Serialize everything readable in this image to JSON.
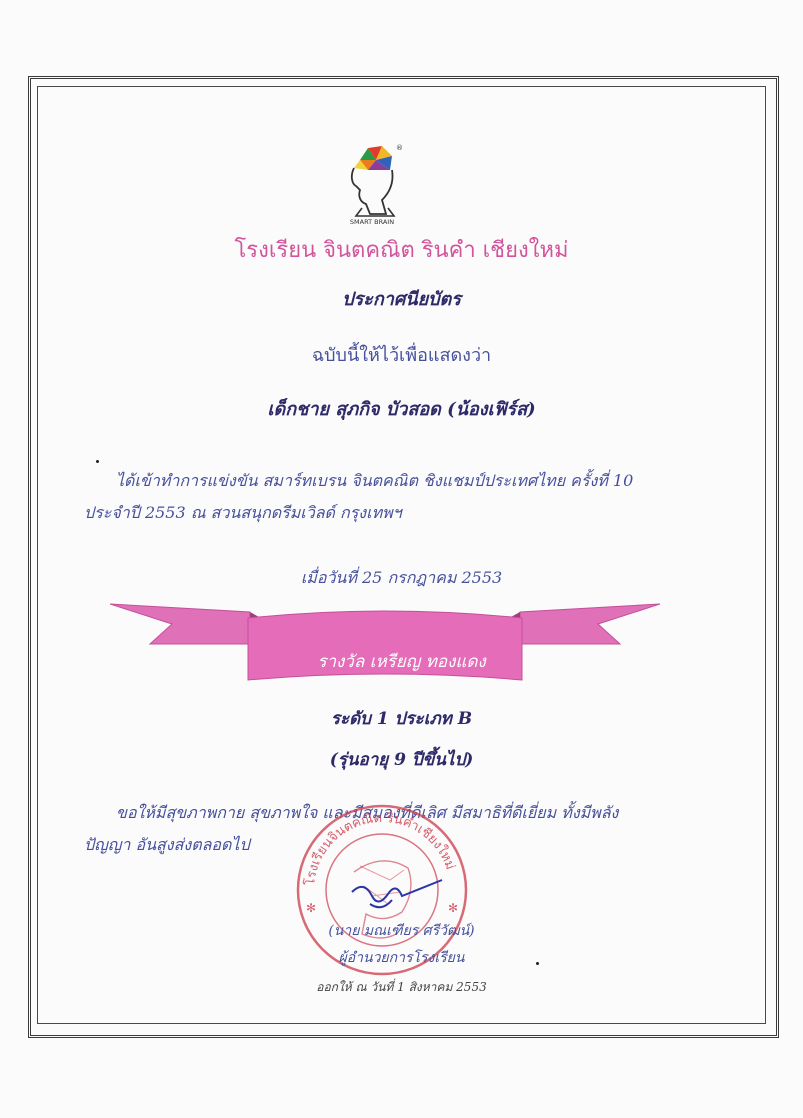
{
  "logo": {
    "caption": "SMART BRAIN",
    "mark": "®"
  },
  "school_name": "โรงเรียน จินตคณิต รินคำ เชียงใหม่",
  "title": "ประกาศนียบัตร",
  "certifies": "ฉบับนี้ให้ไว้เพื่อแสดงว่า",
  "recipient": "เด็กชาย สุภกิจ  บัวสอด  (น้องเฟิร์ส)",
  "body_line1": "ได้เข้าทำการแข่งขัน สมาร์ทเบรน จินตคณิต ชิงแชมป์ประเทศไทย ครั้งที่ 10",
  "body_line2": "ประจำปี 2553 ณ สวนสนุกดรีมเวิลด์ กรุงเทพฯ",
  "date_line": "เมื่อวันที่ 25 กรกฎาคม 2553",
  "award": "รางวัล  เหรียญ ทองแดง",
  "level": "ระดับ 1 ประเภท B",
  "age_group": "(รุ่นอายุ 9 ปีขึ้นไป)",
  "wish_line1": "ขอให้มีสุขภาพกาย สุขภาพใจ และมีสมองที่ดีเลิศ มีสมาธิที่ดีเยี่ยม ทั้งมีพลัง",
  "wish_line2": "ปัญญา อันสูงส่งตลอดไป",
  "stamp_text": "โรงเรียนจินตคณิต รินคำเชียงใหม่",
  "signer": "(นาย มณเฑียร ศรีวัฒน์)",
  "signer_position": "ผู้อำนวยการโรงเรียน",
  "issued": "ออกให้ ณ วันที่  1 สิงหาคม 2553",
  "colors": {
    "pink": "#d2559b",
    "ribbon": "#e070b8",
    "text": "#2e2a68",
    "stamp": "#cc3a4a",
    "signature": "#2b35a8"
  }
}
